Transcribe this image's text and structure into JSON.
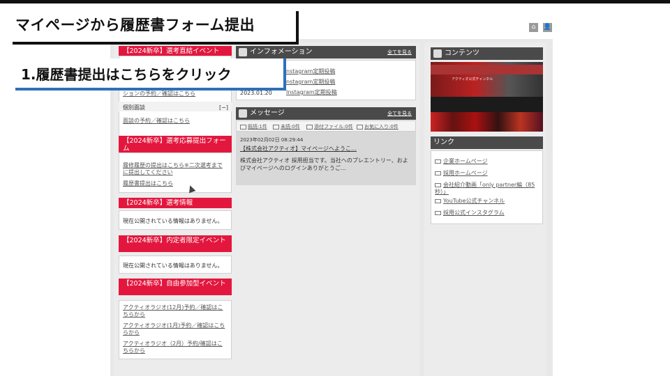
{
  "title": "マイページから履歴書フォーム提出",
  "callout": "1.履歴書提出はこちらをクリック",
  "left": {
    "event_header": "【2024新卒】選考直結イベント",
    "event_link": "ションの予約／確認はこちら",
    "interview_label": "個別面談",
    "interview_toggle": "[−]",
    "interview_link": "面談の予約／確認はこちら",
    "application_header": "【2024新卒】選考応募提出フォーム",
    "application_links": [
      "履修履歴の提出はこちら※二次選考までに提出してください",
      "履歴書提出はこちら"
    ],
    "selection_header": "【2024新卒】選考情報",
    "selection_text": "現在公開されている情報はありません。",
    "offer_header": "【2024新卒】内定者限定イベント",
    "offer_text": "現在公開されている情報はありません。",
    "free_header": "【2024新卒】自由参加型イベント",
    "free_links": [
      "アクティオラジオ(12月)予約／確認はこちらから",
      "アクティオラジオ(1月)予約／確認はこちらから",
      "アクティオラジオ（2月）予約/確認はこちらから"
    ]
  },
  "info": {
    "header": "インフォメーション",
    "more": "全てを見る",
    "rows": [
      {
        "date": "",
        "text": "nstagram定期投稿"
      },
      {
        "date": "",
        "text": "nstagram定期投稿"
      },
      {
        "date": "2023.01.20",
        "text": "Instagram定期投稿"
      }
    ]
  },
  "message": {
    "header": "メッセージ",
    "more": "全てを見る",
    "tabs": [
      "既読:1件",
      "未読:0件",
      "添付ファイル:0件",
      "お気に入り:0件"
    ],
    "date": "2023年02月02日 08:29:44",
    "subject": "【株式会社アクティオ】マイページへようこ…",
    "body": "株式会社アクティオ 採用担当です。当社へのプレエントリー、およびマイページへのログインありがとうご…"
  },
  "contents": {
    "header": "コンテンツ",
    "channel": "アクティオ公式チャンネル"
  },
  "links": {
    "header": "リンク",
    "items": [
      "企業ホームページ",
      "採用ホームページ",
      "会社紹介動画「only partner編（85秒）」",
      "YouTube公式チャンネル",
      "採用公式インスタグラム"
    ]
  },
  "colors": {
    "accent_red": "#e3173e",
    "header_dark": "#4a4a4a",
    "callout_blue": "#2f6fb9"
  }
}
